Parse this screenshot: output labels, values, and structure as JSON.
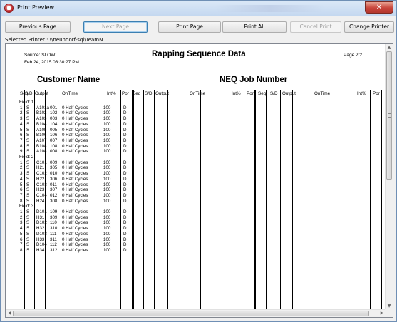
{
  "window": {
    "title": "Print Preview"
  },
  "toolbar": {
    "previous_page": "Previous Page",
    "next_page": "Next Page",
    "print_page": "Print Page",
    "print_all": "Print All",
    "cancel_print": "Cancel Print",
    "change_printer": "Change Printer"
  },
  "printer": {
    "label": "Selected Printer : \\\\neundorf-sql\\TeamN"
  },
  "report": {
    "source": "Source: SLOW",
    "date": "Feb 24, 2015 03:30:27 PM",
    "title": "Rapping Sequence Data",
    "page": "Page 2/2",
    "customer_label": "Customer Name",
    "job_label": "NEQ Job Number",
    "columns": [
      "Seq",
      "S/D",
      "Output",
      "OnTime",
      "Int%",
      "Por"
    ],
    "fields": [
      {
        "label": "Field: 1",
        "rows": [
          {
            "seq": "1",
            "sd": "S",
            "output": "A101a",
            "code": "001",
            "ontime": "0 Half Cycles",
            "int": "100",
            "por": "D"
          },
          {
            "seq": "2",
            "sd": "S",
            "output": "B102",
            "code": "102",
            "ontime": "0 Half Cycles",
            "int": "100",
            "por": "D"
          },
          {
            "seq": "3",
            "sd": "S",
            "output": "A103",
            "code": "003",
            "ontime": "0 Half Cycles",
            "int": "100",
            "por": "D"
          },
          {
            "seq": "4",
            "sd": "S",
            "output": "B104",
            "code": "104",
            "ontime": "0 Half Cycles",
            "int": "100",
            "por": "D"
          },
          {
            "seq": "5",
            "sd": "S",
            "output": "A105",
            "code": "005",
            "ontime": "0 Half Cycles",
            "int": "100",
            "por": "D"
          },
          {
            "seq": "6",
            "sd": "S",
            "output": "B106",
            "code": "106",
            "ontime": "0 Half Cycles",
            "int": "100",
            "por": "D"
          },
          {
            "seq": "7",
            "sd": "S",
            "output": "A107",
            "code": "007",
            "ontime": "0 Half Cycles",
            "int": "100",
            "por": "D"
          },
          {
            "seq": "8",
            "sd": "S",
            "output": "B108",
            "code": "108",
            "ontime": "0 Half Cycles",
            "int": "100",
            "por": "D"
          },
          {
            "seq": "9",
            "sd": "S",
            "output": "A108",
            "code": "008",
            "ontime": "0 Half Cycles",
            "int": "100",
            "por": "D"
          }
        ]
      },
      {
        "label": "Field: 2",
        "rows": [
          {
            "seq": "1",
            "sd": "S",
            "output": "C101",
            "code": "009",
            "ontime": "0 Half Cycles",
            "int": "100",
            "por": "D"
          },
          {
            "seq": "2",
            "sd": "S",
            "output": "H21",
            "code": "305",
            "ontime": "0 Half Cycles",
            "int": "100",
            "por": "D"
          },
          {
            "seq": "3",
            "sd": "S",
            "output": "C102",
            "code": "010",
            "ontime": "0 Half Cycles",
            "int": "100",
            "por": "D"
          },
          {
            "seq": "4",
            "sd": "S",
            "output": "H22",
            "code": "306",
            "ontime": "0 Half Cycles",
            "int": "100",
            "por": "D"
          },
          {
            "seq": "5",
            "sd": "S",
            "output": "C103",
            "code": "011",
            "ontime": "0 Half Cycles",
            "int": "100",
            "por": "D"
          },
          {
            "seq": "6",
            "sd": "S",
            "output": "H23",
            "code": "307",
            "ontime": "0 Half Cycles",
            "int": "100",
            "por": "D"
          },
          {
            "seq": "7",
            "sd": "S",
            "output": "C104",
            "code": "012",
            "ontime": "0 Half Cycles",
            "int": "100",
            "por": "D"
          },
          {
            "seq": "8",
            "sd": "S",
            "output": "H24",
            "code": "308",
            "ontime": "0 Half Cycles",
            "int": "100",
            "por": "D"
          }
        ]
      },
      {
        "label": "Field: 3",
        "rows": [
          {
            "seq": "1",
            "sd": "S",
            "output": "D101",
            "code": "109",
            "ontime": "0 Half Cycles",
            "int": "100",
            "por": "D"
          },
          {
            "seq": "2",
            "sd": "S",
            "output": "H31",
            "code": "309",
            "ontime": "0 Half Cycles",
            "int": "100",
            "por": "D"
          },
          {
            "seq": "3",
            "sd": "S",
            "output": "D102",
            "code": "110",
            "ontime": "0 Half Cycles",
            "int": "100",
            "por": "D"
          },
          {
            "seq": "4",
            "sd": "S",
            "output": "H32",
            "code": "310",
            "ontime": "0 Half Cycles",
            "int": "100",
            "por": "D"
          },
          {
            "seq": "5",
            "sd": "S",
            "output": "D103",
            "code": "111",
            "ontime": "0 Half Cycles",
            "int": "100",
            "por": "D"
          },
          {
            "seq": "6",
            "sd": "S",
            "output": "H33",
            "code": "311",
            "ontime": "0 Half Cycles",
            "int": "100",
            "por": "D"
          },
          {
            "seq": "7",
            "sd": "S",
            "output": "D104",
            "code": "112",
            "ontime": "0 Half Cycles",
            "int": "100",
            "por": "D"
          },
          {
            "seq": "8",
            "sd": "S",
            "output": "H34",
            "code": "312",
            "ontime": "0 Half Cycles",
            "int": "100",
            "por": "D"
          }
        ]
      }
    ]
  },
  "icons": {
    "app": "print-preview-app-icon",
    "close": "close-icon",
    "scroll_up": "arrow-up-icon",
    "scroll_down": "arrow-down-icon",
    "scroll_left": "arrow-left-icon",
    "scroll_right": "arrow-right-icon"
  }
}
